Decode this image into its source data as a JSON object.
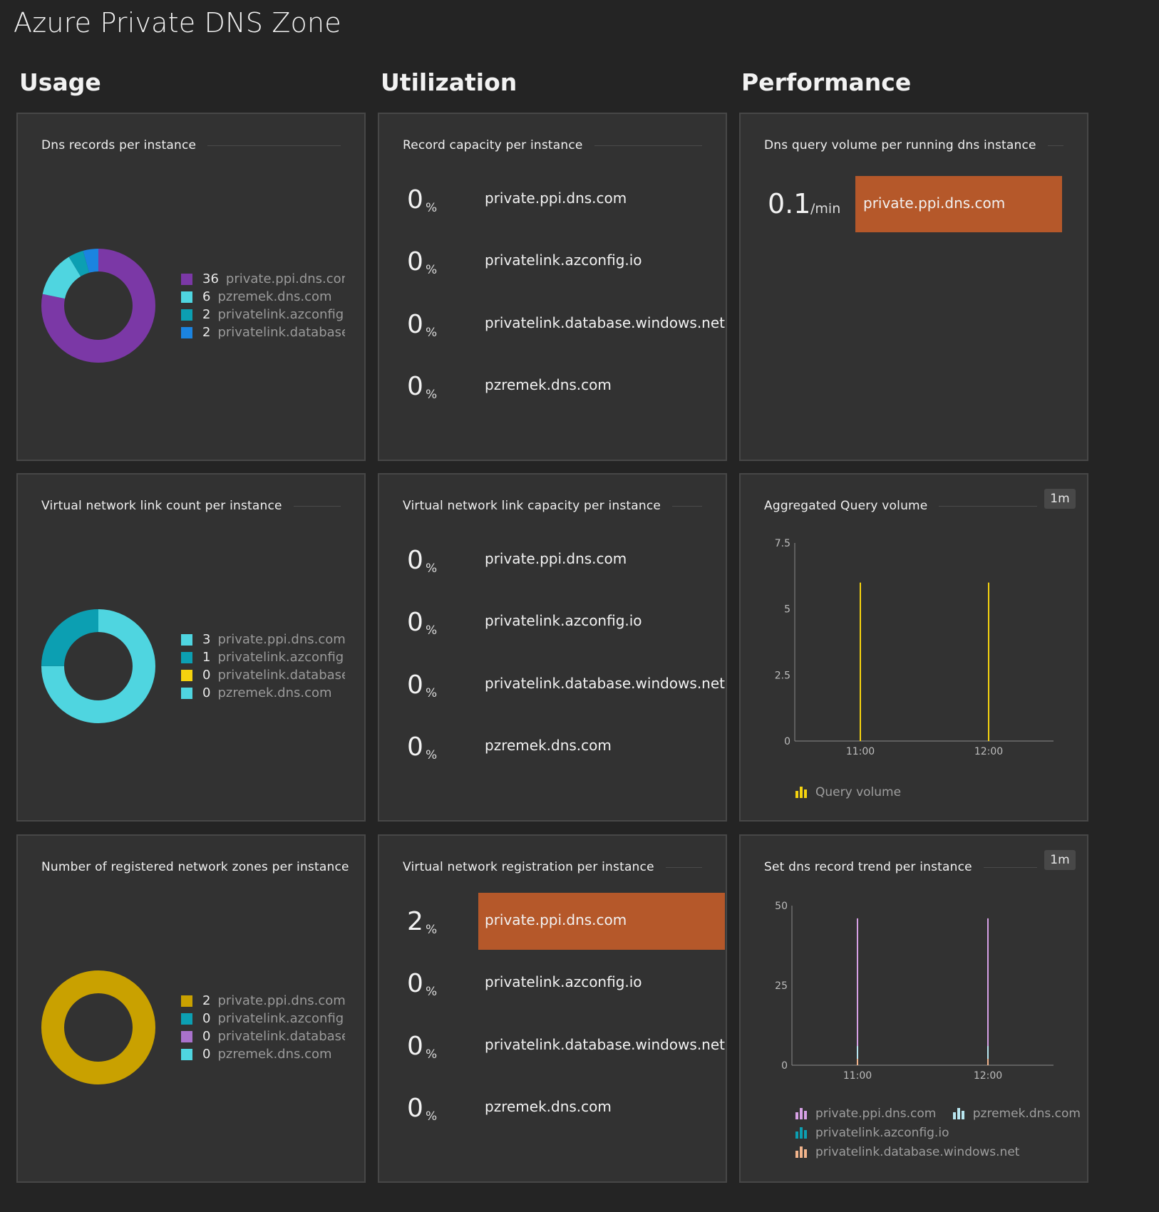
{
  "page": {
    "title": "Azure Private DNS Zone"
  },
  "sections": {
    "usage": "Usage",
    "utilization": "Utilization",
    "performance": "Performance"
  },
  "colors": {
    "purple": "#7b38a6",
    "cyan": "#4fd5e0",
    "teal": "#0c9fb2",
    "blue": "#1b84e0",
    "yellow": "#f5d30f",
    "gold": "#c9a100",
    "lavender": "#a972cc",
    "orange": "#b5582a",
    "peach": "#f2b48c",
    "pink": "#d7a1e6"
  },
  "usage": {
    "dns_records": {
      "title": "Dns records per instance",
      "items": [
        {
          "value": "36",
          "label": "private.ppi.dns.com",
          "color": "#7b38a6"
        },
        {
          "value": "6",
          "label": "pzremek.dns.com",
          "color": "#4fd5e0"
        },
        {
          "value": "2",
          "label": "privatelink.azconfig.io",
          "color": "#0c9fb2"
        },
        {
          "value": "2",
          "label": "privatelink.database.windows.net",
          "color": "#1b84e0"
        }
      ]
    },
    "vnet_link_count": {
      "title": "Virtual network link count per instance",
      "items": [
        {
          "value": "3",
          "label": "private.ppi.dns.com",
          "color": "#4fd5e0"
        },
        {
          "value": "1",
          "label": "privatelink.azconfig.io",
          "color": "#0c9fb2"
        },
        {
          "value": "0",
          "label": "privatelink.database.windows.net",
          "color": "#f5d30f"
        },
        {
          "value": "0",
          "label": "pzremek.dns.com",
          "color": "#4fd5e0"
        }
      ]
    },
    "registered_zones": {
      "title": "Number of registered network zones per instance",
      "items": [
        {
          "value": "2",
          "label": "private.ppi.dns.com",
          "color": "#c9a100"
        },
        {
          "value": "0",
          "label": "privatelink.azconfig.io",
          "color": "#0c9fb2"
        },
        {
          "value": "0",
          "label": "privatelink.database.windows.net",
          "color": "#a972cc"
        },
        {
          "value": "0",
          "label": "pzremek.dns.com",
          "color": "#4fd5e0"
        }
      ]
    }
  },
  "utilization": {
    "record_capacity": {
      "title": "Record capacity per instance",
      "rows": [
        {
          "value": "0",
          "unit": "%",
          "name": "private.ppi.dns.com",
          "highlight": false
        },
        {
          "value": "0",
          "unit": "%",
          "name": "privatelink.azconfig.io",
          "highlight": false
        },
        {
          "value": "0",
          "unit": "%",
          "name": "privatelink.database.windows.net",
          "highlight": false
        },
        {
          "value": "0",
          "unit": "%",
          "name": "pzremek.dns.com",
          "highlight": false
        }
      ]
    },
    "vnet_link_capacity": {
      "title": "Virtual network link capacity per instance",
      "rows": [
        {
          "value": "0",
          "unit": "%",
          "name": "private.ppi.dns.com",
          "highlight": false
        },
        {
          "value": "0",
          "unit": "%",
          "name": "privatelink.azconfig.io",
          "highlight": false
        },
        {
          "value": "0",
          "unit": "%",
          "name": "privatelink.database.windows.net",
          "highlight": false
        },
        {
          "value": "0",
          "unit": "%",
          "name": "pzremek.dns.com",
          "highlight": false
        }
      ]
    },
    "vnet_registration": {
      "title": "Virtual network registration per instance",
      "rows": [
        {
          "value": "2",
          "unit": "%",
          "name": "private.ppi.dns.com",
          "highlight": true
        },
        {
          "value": "0",
          "unit": "%",
          "name": "privatelink.azconfig.io",
          "highlight": false
        },
        {
          "value": "0",
          "unit": "%",
          "name": "privatelink.database.windows.net",
          "highlight": false
        },
        {
          "value": "0",
          "unit": "%",
          "name": "pzremek.dns.com",
          "highlight": false
        }
      ]
    }
  },
  "performance": {
    "query_volume": {
      "title": "Dns query volume per running dns instance",
      "value": "0.1",
      "unit": "/min",
      "name": "private.ppi.dns.com"
    },
    "aggregated": {
      "title": "Aggregated Query volume",
      "badge": "1m",
      "legend": "Query volume"
    },
    "record_trend": {
      "title": "Set dns record trend per instance",
      "badge": "1m",
      "legend": [
        "private.ppi.dns.com",
        "pzremek.dns.com",
        "privatelink.azconfig.io",
        "privatelink.database.windows.net"
      ]
    }
  },
  "chart_data": [
    {
      "type": "bar",
      "title": "Aggregated Query volume",
      "x_ticks": [
        "11:00",
        "12:00"
      ],
      "y_ticks": [
        "0",
        "2.5",
        "5",
        "7.5"
      ],
      "ylim": [
        0,
        7.5
      ],
      "series": [
        {
          "name": "Query volume",
          "color": "#f5d30f",
          "points": [
            {
              "x": "11:00",
              "y": 6
            },
            {
              "x": "12:00",
              "y": 6
            }
          ]
        }
      ]
    },
    {
      "type": "bar",
      "title": "Set dns record trend per instance",
      "x_ticks": [
        "11:00",
        "12:00"
      ],
      "y_ticks": [
        "0",
        "25",
        "50"
      ],
      "ylim": [
        0,
        50
      ],
      "series": [
        {
          "name": "private.ppi.dns.com",
          "color": "#d7a1e6",
          "points": [
            {
              "x": "11:00",
              "y": 46
            },
            {
              "x": "12:00",
              "y": 46
            }
          ]
        },
        {
          "name": "pzremek.dns.com",
          "color": "#b8e6f0",
          "points": [
            {
              "x": "11:00",
              "y": 6
            },
            {
              "x": "12:00",
              "y": 6
            }
          ]
        },
        {
          "name": "privatelink.azconfig.io",
          "color": "#0c9fb2",
          "points": [
            {
              "x": "11:00",
              "y": 2
            },
            {
              "x": "12:00",
              "y": 2
            }
          ]
        },
        {
          "name": "privatelink.database.windows.net",
          "color": "#f2b48c",
          "points": [
            {
              "x": "11:00",
              "y": 2
            },
            {
              "x": "12:00",
              "y": 2
            }
          ]
        }
      ]
    }
  ]
}
